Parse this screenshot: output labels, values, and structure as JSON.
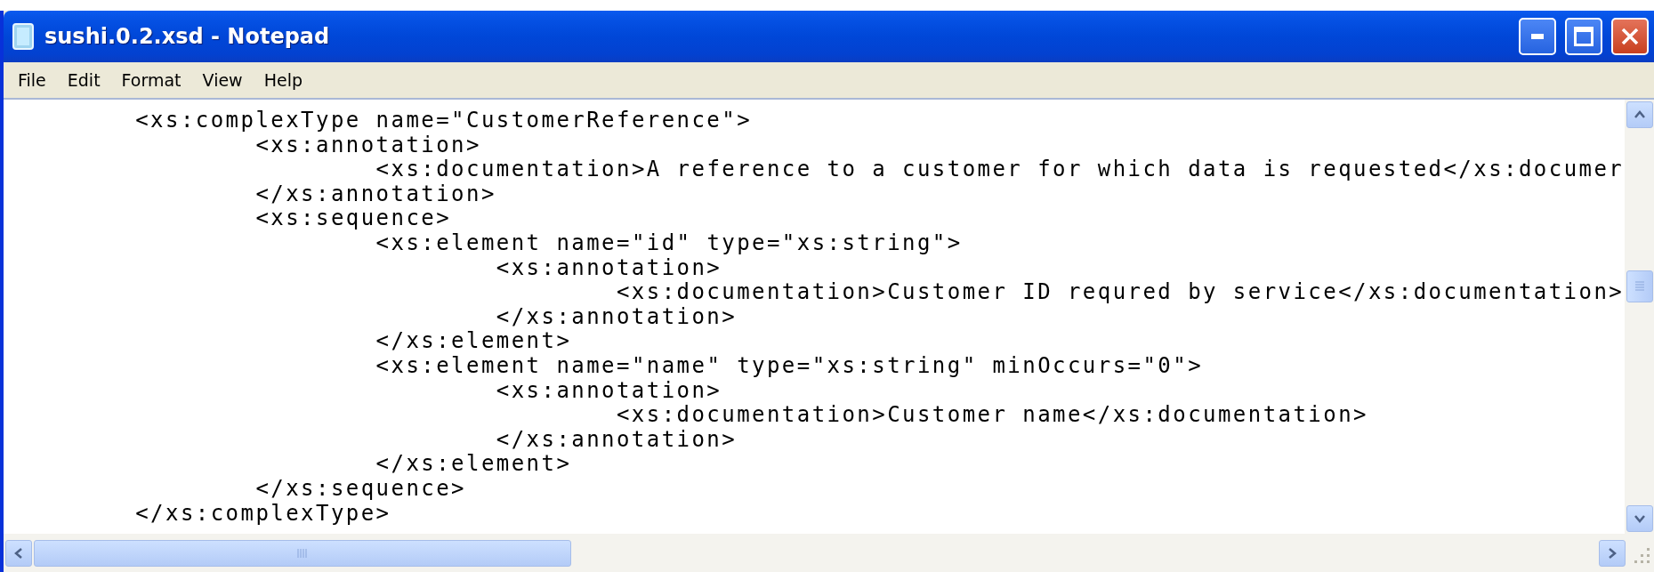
{
  "window": {
    "title": "sushi.0.2.xsd - Notepad"
  },
  "menu": [
    {
      "label": "File"
    },
    {
      "label": "Edit"
    },
    {
      "label": "Format"
    },
    {
      "label": "View"
    },
    {
      "label": "Help"
    }
  ],
  "document": {
    "lines": [
      "\t<xs:complexType name=\"CustomerReference\">",
      "\t\t<xs:annotation>",
      "\t\t\t<xs:documentation>A reference to a customer for which data is requested</xs:documer",
      "\t\t</xs:annotation>",
      "\t\t<xs:sequence>",
      "\t\t\t<xs:element name=\"id\" type=\"xs:string\">",
      "\t\t\t\t<xs:annotation>",
      "\t\t\t\t\t<xs:documentation>Customer ID requred by service</xs:documentation>",
      "\t\t\t\t</xs:annotation>",
      "\t\t\t</xs:element>",
      "\t\t\t<xs:element name=\"name\" type=\"xs:string\" minOccurs=\"0\">",
      "\t\t\t\t<xs:annotation>",
      "\t\t\t\t\t<xs:documentation>Customer name</xs:documentation>",
      "\t\t\t\t</xs:annotation>",
      "\t\t\t</xs:element>",
      "\t\t</xs:sequence>",
      "\t</xs:complexType>"
    ]
  }
}
